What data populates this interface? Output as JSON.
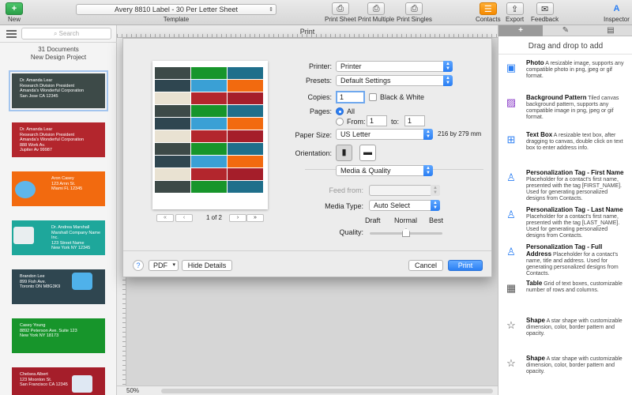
{
  "toolbar": {
    "new_label": "New",
    "template_value": "Avery 8810 Label - 30 Per Letter Sheet",
    "template_label": "Template",
    "print_sheet": "Print Sheet",
    "print_multiple": "Print Multiple",
    "print_singles": "Print Singles",
    "contacts": "Contacts",
    "export": "Export",
    "feedback": "Feedback",
    "inspector": "Inspector"
  },
  "left_sidebar": {
    "search_placeholder": "Search",
    "doc_count": "31 Documents",
    "project_name": "New Design Project",
    "labels": [
      {
        "lines": [
          "Dr. Amanda Lear",
          "Research Division President",
          "Amanda's Wonderful Corporation",
          "San Jose CA 12345"
        ],
        "color": "#3d4a48"
      },
      {
        "lines": [
          "Dr. Amanda Lear",
          "Research Division President",
          "Amanda's Wonderful Corporation",
          "888 Work Av.",
          "Jupiter Av  99987"
        ],
        "color": "#b3262d"
      },
      {
        "lines": [
          "Aron Casey",
          "123 Arnn St.",
          "Miami FL 12345"
        ],
        "color": "#f26a0f"
      },
      {
        "lines": [
          "Dr. Andrea Marshall",
          "Marshall Company Name Inc.",
          "123 Street Name",
          "New York NY 12345"
        ],
        "color": "#1ea79b"
      },
      {
        "lines": [
          "Brandon Lee",
          "899 Fish Ave.",
          "Toronto ON M8G3K9"
        ],
        "color": "#2f4650"
      },
      {
        "lines": [
          "Casey Young",
          "8892 Peterson Ave. Suite 123",
          "New York NY 18173"
        ],
        "color": "#17952b"
      },
      {
        "lines": [
          "Chelsea Albert",
          "123 Moonton St.",
          "San Francisco CA 12345"
        ],
        "color": "#a51e2a"
      }
    ]
  },
  "canvas": {
    "title": "Print",
    "zoom": "50%"
  },
  "print_dialog": {
    "printer_label": "Printer:",
    "printer_value": "Printer",
    "presets_label": "Presets:",
    "presets_value": "Default Settings",
    "copies_label": "Copies:",
    "copies_value": "1",
    "bw_label": "Black & White",
    "pages_label": "Pages:",
    "pages_all": "All",
    "pages_from": "From:",
    "from_value": "1",
    "to_label": "to:",
    "to_value": "1",
    "paper_label": "Paper Size:",
    "paper_value": "US Letter",
    "paper_dims": "216 by 279 mm",
    "orientation_label": "Orientation:",
    "section_value": "Media & Quality",
    "feed_label": "Feed from:",
    "media_label": "Media Type:",
    "media_value": "Auto Select",
    "quality_label": "Quality:",
    "q_draft": "Draft",
    "q_normal": "Normal",
    "q_best": "Best",
    "page_indicator": "1 of 2",
    "pdf_label": "PDF",
    "hide_details": "Hide Details",
    "cancel": "Cancel",
    "print": "Print",
    "quality_level": 0.5
  },
  "right_sidebar": {
    "header": "Drag and drop to add",
    "tools": [
      {
        "name": "Photo",
        "desc": "A resizable image, supports any compatible photo in png, jpeg or gif format.",
        "icon": "photo-icon"
      },
      {
        "name": "Background Pattern",
        "desc": "Tiled canvas background pattern, supports any compatible image in png, jpeg or gif format.",
        "icon": "pattern-icon"
      },
      {
        "name": "Text Box",
        "desc": "A resizable text box, after dragging to canvas, double click on text box to enter address info.",
        "icon": "textbox-icon"
      },
      {
        "name": "Personalization Tag - First Name",
        "desc": "Placeholder for a contact's first name, presented with the tag [FIRST_NAME]. Used for generating personalized designs from Contacts.",
        "icon": "person-icon"
      },
      {
        "name": "Personalization Tag - Last Name",
        "desc": "Placeholder for a contact's first name, presented with the tag [LAST_NAME]. Used for generating personalized designs from Contacts.",
        "icon": "person-icon"
      },
      {
        "name": "Personalization Tag - Full Address",
        "desc": "Placeholder for a contact's name, title and address. Used for generating personalized designs from Contacts.",
        "icon": "person-icon"
      },
      {
        "name": "Table",
        "desc": "Grid of text boxes, customizable number of rows and columns.",
        "icon": "table-icon"
      },
      {
        "name": "Shape",
        "desc": "A star shape with customizable dimension, color, border pattern and opacity.",
        "icon": "star-icon"
      },
      {
        "name": "Shape",
        "desc": "A star shape with customizable dimension, color, border pattern and opacity.",
        "icon": "star-icon"
      }
    ]
  },
  "colors": {
    "accent": "#2a7ef3",
    "new_button": "#34b04f",
    "contacts_button": "#f58a00"
  }
}
